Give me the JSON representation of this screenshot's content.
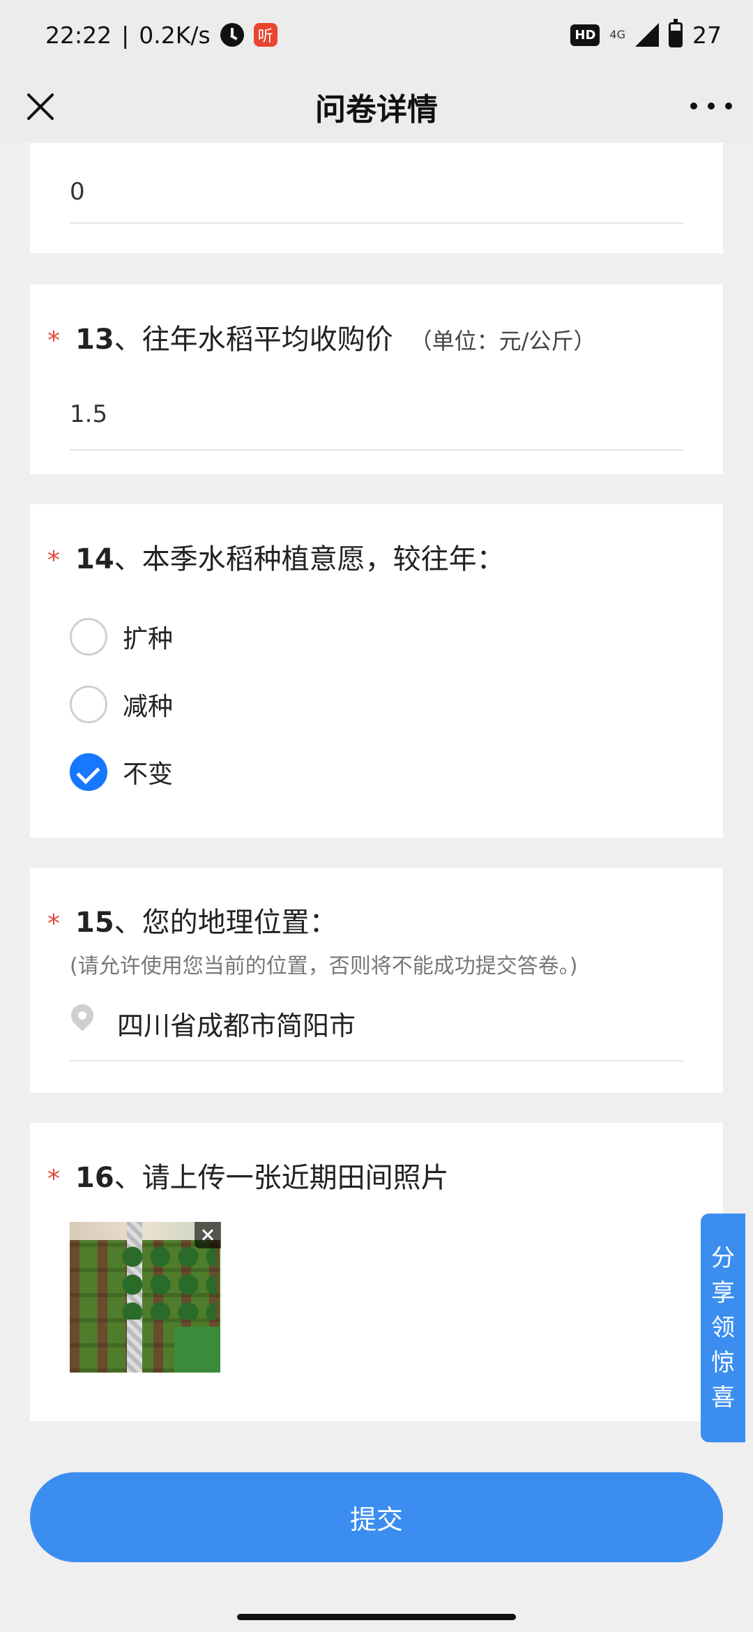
{
  "status_bar": {
    "time": "22:22",
    "speed": "0.2K/s",
    "listen_glyph": "听",
    "hd": "HD",
    "network": "4G",
    "battery": "27"
  },
  "header": {
    "title": "问卷详情"
  },
  "q12": {
    "answer": "0"
  },
  "q13": {
    "star": "*",
    "number": "13",
    "title": "、往年水稻平均收购价",
    "unit": "（单位：元/公斤）",
    "answer": "1.5"
  },
  "q14": {
    "star": "*",
    "number": "14",
    "title": "、本季水稻种植意愿，较往年：",
    "options": [
      {
        "label": "扩种",
        "checked": false
      },
      {
        "label": "减种",
        "checked": false
      },
      {
        "label": "不变",
        "checked": true
      }
    ]
  },
  "q15": {
    "star": "*",
    "number": "15",
    "title": "、您的地理位置：",
    "hint": "(请允许使用您当前的位置，否则将不能成功提交答卷。)",
    "location": "四川省成都市简阳市"
  },
  "q16": {
    "star": "*",
    "number": "16",
    "title": "、请上传一张近期田间照片"
  },
  "share_tab": {
    "chars": [
      "分",
      "享",
      "领",
      "惊",
      "喜"
    ]
  },
  "submit": {
    "label": "提交"
  },
  "icons": {
    "close": "close-icon",
    "more": "more-icon",
    "location": "location-pin-icon",
    "checked": "check-icon"
  },
  "colors": {
    "accent": "#3b8ef0",
    "required": "#e0473c",
    "background": "#efefef"
  }
}
